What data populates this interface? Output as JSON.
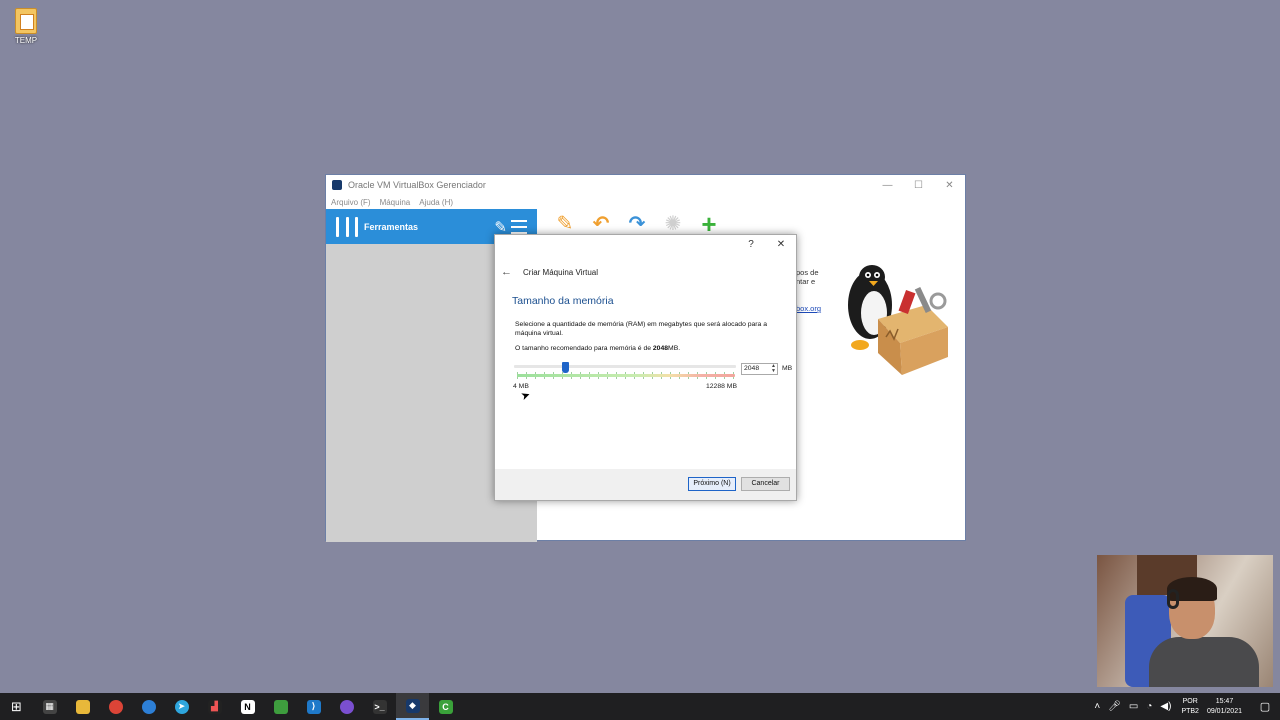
{
  "desktop": {
    "icon_label": "TEMP"
  },
  "window": {
    "title": "Oracle VM VirtualBox Gerenciador",
    "controls": {
      "minimize": "—",
      "maximize": "☐",
      "close": "✕"
    },
    "menu": [
      "Arquivo (F)",
      "Máquina",
      "Ajuda (H)"
    ],
    "tools_label": "Ferramentas",
    "welcome_text": [
      "pos de",
      "ntar e"
    ],
    "welcome_link": "box.org"
  },
  "toolbar": {
    "icons": [
      "wrench-icon",
      "import-icon",
      "export-icon",
      "gear-icon",
      "add-icon"
    ]
  },
  "dialog": {
    "help": "?",
    "close": "✕",
    "back": "←",
    "title": "Criar Máquina Virtual",
    "heading": "Tamanho da memória",
    "description": "Selecione a quantidade de memória (RAM) em megabytes que será alocado para a máquina virtual.",
    "recommended_prefix": "O tamanho recomendado para memória é de ",
    "recommended_value": "2048",
    "recommended_suffix": "MB.",
    "slider": {
      "min_label": "4 MB",
      "max_label": "12288 MB",
      "value_mb": 2048,
      "min_mb": 4,
      "max_mb": 12288
    },
    "spin_value": "2048",
    "unit": "MB",
    "next_label": "Próximo (N)",
    "cancel_label": "Cancelar"
  },
  "taskbar": {
    "lang_top": "POR",
    "lang_bottom": "PTB2",
    "time": "15:47",
    "date": "09/01/2021"
  },
  "colors": {
    "desktop": "#85879f",
    "accent": "#2b8ed9",
    "heading": "#1b4f8f",
    "slider_thumb": "#1e64c8"
  }
}
